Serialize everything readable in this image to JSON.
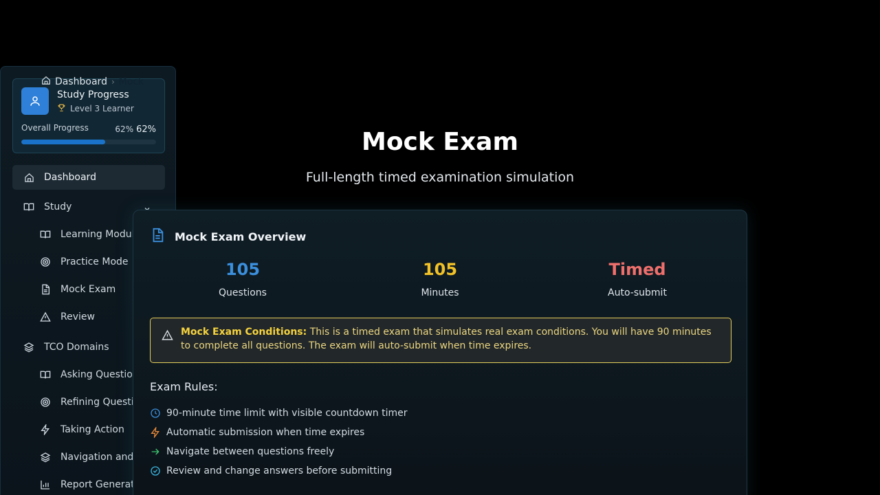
{
  "breadcrumb": {
    "home_label": "Dashboard",
    "current_label": "Mock"
  },
  "progress_card": {
    "title": "Study Progress",
    "level": "Level 3 Learner",
    "overall_label": "Overall Progress",
    "percent_small": "62%",
    "percent_large": "62%",
    "progress_fraction": 0.62,
    "accent_color": "#2f80d8"
  },
  "nav": {
    "dashboard": "Dashboard",
    "study": "Study",
    "learning_modules": "Learning Modules",
    "practice_mode": "Practice Mode",
    "mock_exam": "Mock Exam",
    "review": "Review",
    "tco_domains": "TCO Domains",
    "asking_questions": "Asking Questions",
    "refining_questions": "Refining Questions",
    "taking_action": "Taking Action",
    "navigation": "Navigation and ...",
    "report_generation": "Report Generati..."
  },
  "hero": {
    "title": "Mock Exam",
    "subtitle": "Full-length timed examination simulation"
  },
  "overview": {
    "title": "Mock Exam Overview",
    "stats": [
      {
        "value": "105",
        "label": "Questions",
        "color": "#3b8fdc"
      },
      {
        "value": "105",
        "label": "Minutes",
        "color": "#f2c227"
      },
      {
        "value": "Timed",
        "label": "Auto-submit",
        "color": "#ef6f6c"
      }
    ],
    "warning": {
      "label": "Mock Exam Conditions:",
      "text": "This is a timed exam that simulates real exam conditions. You will have 90 minutes to complete all questions. The exam will auto-submit when time expires."
    },
    "rules_title": "Exam Rules:",
    "rules": [
      {
        "text": "90-minute time limit with visible countdown timer",
        "icon": "clock-icon"
      },
      {
        "text": "Automatic submission when time expires",
        "icon": "lightning-icon"
      },
      {
        "text": "Navigate between questions freely",
        "icon": "arrow-right-icon"
      },
      {
        "text": "Review and change answers before submitting",
        "icon": "check-circle-icon"
      }
    ]
  }
}
